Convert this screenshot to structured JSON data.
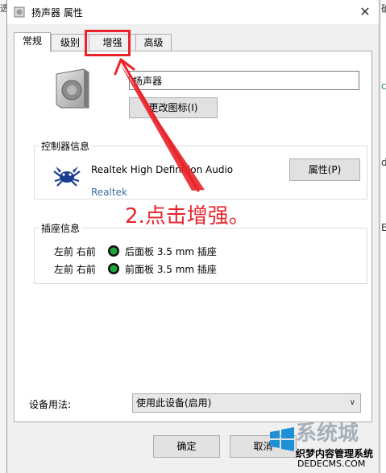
{
  "window": {
    "title": "扬声器 属性"
  },
  "background": {
    "left_fragment": "选",
    "right_fragments": [
      "确",
      "c",
      "d",
      "E"
    ]
  },
  "tabs": [
    {
      "label": "常规",
      "active": true
    },
    {
      "label": "级别",
      "active": false
    },
    {
      "label": "增强",
      "active": false
    },
    {
      "label": "高级",
      "active": false
    }
  ],
  "device": {
    "name": "扬声器",
    "change_icon_label": "更改图标(I)"
  },
  "controller": {
    "group_label": "控制器信息",
    "name": "Realtek High Definition Audio",
    "vendor": "Realtek",
    "properties_label": "属性(P)"
  },
  "jacks": {
    "group_label": "插座信息",
    "rows": [
      {
        "position": "左前 右前",
        "description": "后面板 3.5 mm 插座",
        "color": "#1fa83a"
      },
      {
        "position": "左前 右前",
        "description": "前面板 3.5 mm 插座",
        "color": "#1fa83a"
      }
    ]
  },
  "usage": {
    "label": "设备用法:",
    "selected": "使用此设备(启用)"
  },
  "footer": {
    "ok_label": "确定",
    "cancel_label": "取消"
  },
  "annotation": {
    "text": "2.点击增强。",
    "color": "#e8232a"
  },
  "watermark": {
    "top": "系统城",
    "line1": "织梦内容管理系统",
    "line2": "DEDECMS.COM"
  }
}
